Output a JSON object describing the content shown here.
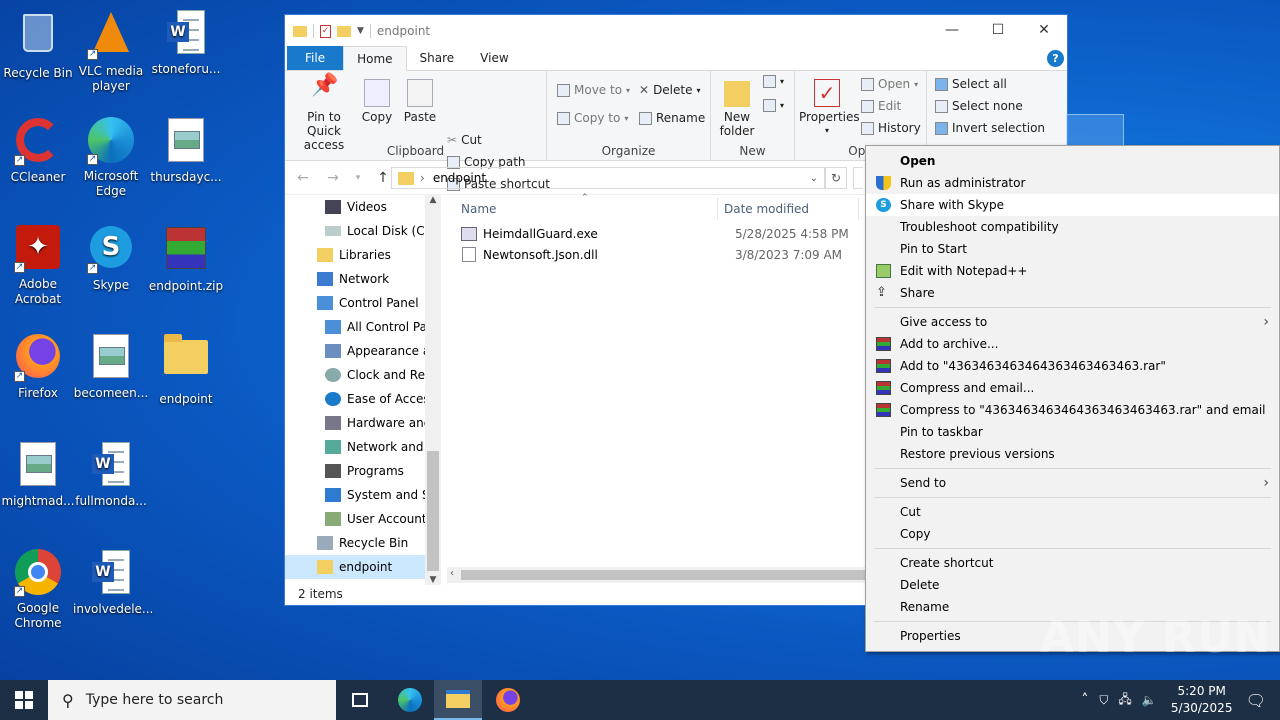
{
  "desktop": {
    "icons": [
      {
        "label": "Recycle Bin"
      },
      {
        "label": "VLC media player"
      },
      {
        "label": "stoneforu..."
      },
      {
        "label": "CCleaner"
      },
      {
        "label": "Microsoft Edge"
      },
      {
        "label": "thursdayc..."
      },
      {
        "label": "Adobe Acrobat"
      },
      {
        "label": "Skype"
      },
      {
        "label": "endpoint.zip"
      },
      {
        "label": "Firefox"
      },
      {
        "label": "becomeen..."
      },
      {
        "label": "endpoint"
      },
      {
        "label": "mightmad..."
      },
      {
        "label": "fullmonda..."
      },
      {
        "label": "Google Chrome"
      },
      {
        "label": "involvedele..."
      }
    ]
  },
  "explorer": {
    "title": "endpoint",
    "tabs": {
      "file": "File",
      "home": "Home",
      "share": "Share",
      "view": "View"
    },
    "help": "?",
    "ribbon": {
      "clipboard": {
        "label": "Clipboard",
        "pin": "Pin to Quick access",
        "copy": "Copy",
        "paste": "Paste",
        "cut": "Cut",
        "copy_path": "Copy path",
        "paste_shortcut": "Paste shortcut"
      },
      "organize": {
        "label": "Organize",
        "move_to": "Move to",
        "copy_to": "Copy to",
        "delete": "Delete",
        "rename": "Rename"
      },
      "new": {
        "label": "New",
        "new_folder": "New folder"
      },
      "open": {
        "label": "Ope",
        "properties": "Properties",
        "open": "Open",
        "edit": "Edit",
        "history": "History"
      },
      "select": {
        "select_all": "Select all",
        "select_none": "Select none",
        "invert": "Invert selection"
      }
    },
    "address": {
      "path": "endpoint"
    },
    "tree": [
      {
        "label": "Videos"
      },
      {
        "label": "Local Disk (C:)"
      },
      {
        "label": "Libraries"
      },
      {
        "label": "Network"
      },
      {
        "label": "Control Panel"
      },
      {
        "label": "All Control Par"
      },
      {
        "label": "Appearance an"
      },
      {
        "label": "Clock and Regi"
      },
      {
        "label": "Ease of Access"
      },
      {
        "label": "Hardware and"
      },
      {
        "label": "Network and Ir"
      },
      {
        "label": "Programs"
      },
      {
        "label": "System and Sec"
      },
      {
        "label": "User Accounts"
      },
      {
        "label": "Recycle Bin"
      },
      {
        "label": "endpoint"
      }
    ],
    "columns": {
      "name": "Name",
      "date": "Date modified"
    },
    "files": [
      {
        "name": "HeimdallGuard.exe",
        "date": "5/28/2025 4:58 PM"
      },
      {
        "name": "Newtonsoft.Json.dll",
        "date": "3/8/2023 7:09 AM"
      }
    ],
    "status": "2 items"
  },
  "context_menu": {
    "items": [
      "Open",
      "Run as administrator",
      "Share with Skype",
      "Troubleshoot compatibility",
      "Pin to Start",
      "Edit with Notepad++",
      "Share",
      "Give access to",
      "Add to archive...",
      "Add to \"4363463463464363463463463.rar\"",
      "Compress and email...",
      "Compress to \"4363463463464363463463463.rar\" and email",
      "Pin to taskbar",
      "Restore previous versions",
      "Send to",
      "Cut",
      "Copy",
      "Create shortcut",
      "Delete",
      "Rename",
      "Properties"
    ]
  },
  "taskbar": {
    "search_placeholder": "Type here to search",
    "time": "5:20 PM",
    "date": "5/30/2025"
  },
  "watermark": "ANY RUN"
}
